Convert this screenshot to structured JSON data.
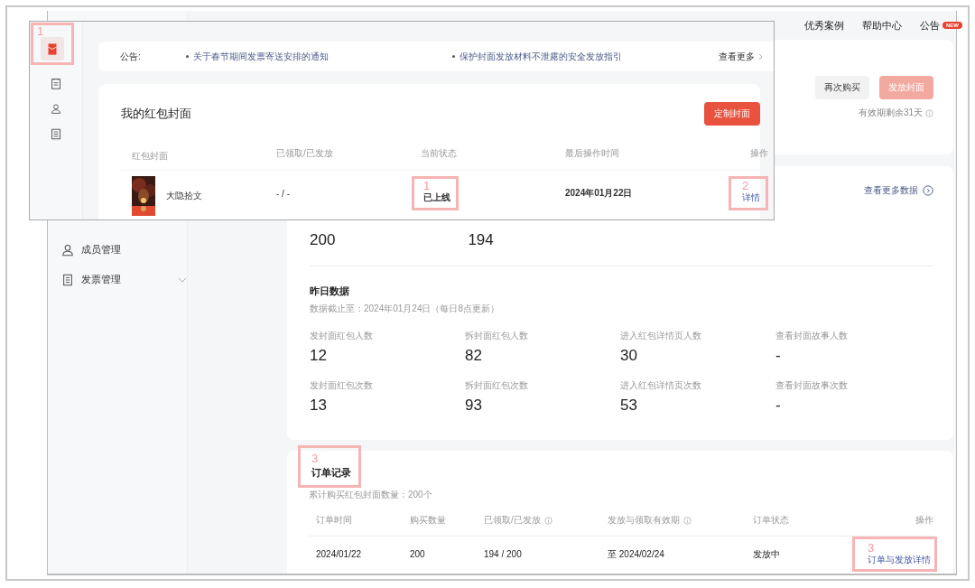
{
  "top_nav": [
    {
      "label": "优秀案例"
    },
    {
      "label": "帮助中心"
    },
    {
      "label": "公告",
      "badge": "NEW"
    }
  ],
  "sidebar": {
    "items": [
      {
        "label": "成员管理",
        "expandable": false
      },
      {
        "label": "发票管理",
        "expandable": true
      }
    ]
  },
  "cover_card": {
    "buttons": [
      {
        "label": "再次购买",
        "kind": "secondary",
        "disabled": false
      },
      {
        "label": "发放封面",
        "kind": "primary",
        "disabled": true
      }
    ],
    "validity": "有效期剩余31天"
  },
  "data_card": {
    "more_link": "查看更多数据",
    "totals": [
      {
        "value": "200"
      },
      {
        "value": "194"
      }
    ],
    "yesterday": {
      "title": "昨日数据",
      "note": "数据截止至：2024年01月24日（每日8点更新）",
      "metrics": [
        {
          "label": "发封面红包人数",
          "value": "12"
        },
        {
          "label": "拆封面红包人数",
          "value": "82"
        },
        {
          "label": "进入红包详情页人数",
          "value": "30"
        },
        {
          "label": "查看封面故事人数",
          "value": "-"
        },
        {
          "label": "发封面红包次数",
          "value": "13"
        },
        {
          "label": "拆封面红包次数",
          "value": "93"
        },
        {
          "label": "进入红包详情页次数",
          "value": "53"
        },
        {
          "label": "查看封面故事次数",
          "value": "-"
        }
      ]
    }
  },
  "order_card": {
    "title": "订单记录",
    "callout": "3",
    "summary": "累计购买红包封面数量：200个",
    "columns": [
      {
        "label": "订单时间",
        "kind": "plain"
      },
      {
        "label": "购买数量",
        "kind": "plain"
      },
      {
        "label": "已领取/已发放",
        "kind": "with_info"
      },
      {
        "label": "发放与领取有效期",
        "kind": "with_info"
      },
      {
        "label": "订单状态",
        "kind": "plain"
      },
      {
        "label": "操作",
        "kind": "plain"
      }
    ],
    "rows": [
      {
        "cells": [
          "2024/01/22",
          "200",
          "194 / 200",
          "至 2024/02/24",
          "发放中"
        ],
        "action": "订单与发放详情",
        "action_callout": "3"
      }
    ]
  },
  "inset": {
    "rail": [
      {
        "selected": true,
        "callout": "1"
      },
      {
        "selected": false
      },
      {
        "selected": false
      },
      {
        "selected": false
      }
    ],
    "notice": {
      "label": "公告:",
      "links": [
        "关于春节期间发票寄送安排的通知",
        "保护封面发放材料不泄露的安全发放指引"
      ],
      "more": "查看更多"
    },
    "covers_card": {
      "title": "我的红包封面",
      "button": "定制封面",
      "columns": [
        "红包封面",
        "已领取/已发放",
        "当前状态",
        "最后操作时间",
        "操作"
      ],
      "rows": [
        {
          "name": "大隐拾文",
          "claimed": "- / -",
          "status": "已上线",
          "status_callout": "1",
          "last_time": "2024年01月22日",
          "action": "详情",
          "action_callout": "2"
        }
      ]
    }
  }
}
